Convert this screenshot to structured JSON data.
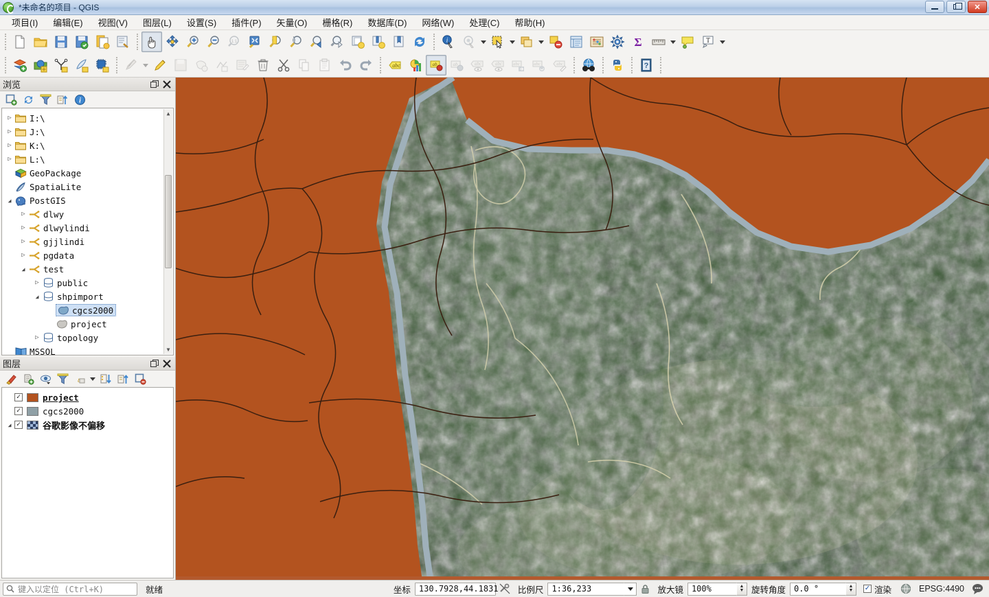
{
  "window": {
    "title": "*未命名的项目 - QGIS",
    "logo_icon": "qgis-logo-icon",
    "minimize_label": "最小化",
    "maximize_label": "最大化",
    "close_label": "关闭"
  },
  "menubar": {
    "items": [
      {
        "label": "项目(I)",
        "name": "menu-project"
      },
      {
        "label": "编辑(E)",
        "name": "menu-edit"
      },
      {
        "label": "视图(V)",
        "name": "menu-view"
      },
      {
        "label": "图层(L)",
        "name": "menu-layer"
      },
      {
        "label": "设置(S)",
        "name": "menu-settings"
      },
      {
        "label": "插件(P)",
        "name": "menu-plugins"
      },
      {
        "label": "矢量(O)",
        "name": "menu-vector"
      },
      {
        "label": "栅格(R)",
        "name": "menu-raster"
      },
      {
        "label": "数据库(D)",
        "name": "menu-database"
      },
      {
        "label": "网络(W)",
        "name": "menu-web"
      },
      {
        "label": "处理(C)",
        "name": "menu-processing"
      },
      {
        "label": "帮助(H)",
        "name": "menu-help"
      }
    ]
  },
  "toolbars": {
    "row1": [
      "new-project-icon",
      "open-project-icon",
      "save-project-icon",
      "save-project-as-icon",
      "new-print-layout-icon",
      "style-manager-icon",
      "sep",
      "pan-map-icon",
      "pan-to-selection-icon",
      "zoom-in-icon",
      "zoom-out-icon",
      "zoom-native-icon",
      "zoom-full-icon",
      "zoom-to-selection-icon",
      "zoom-to-layer-icon",
      "zoom-last-icon",
      "zoom-next-icon",
      "new-map-view-icon",
      "new-3d-map-view-icon",
      "new-bookmark-icon",
      "refresh-icon",
      "sep",
      "identify-features-icon",
      "measure-icon",
      "caret",
      "select-features-icon",
      "caret",
      "deselect-icon",
      "caret",
      "deselect-all-icon",
      "open-attribute-table-icon",
      "field-calculator-icon",
      "options-icon",
      "statistics-icon",
      "measure-line-icon",
      "caret",
      "map-tips-icon",
      "text-annotation-icon",
      "caret"
    ],
    "row2": [
      "add-layer-icon",
      "add-raster-layer-icon",
      "add-mesh-layer-icon",
      "add-delimited-text-icon",
      "add-virtual-layer-icon",
      "sep",
      "current-edits-icon",
      "caret2",
      "toggle-editing-icon",
      "save-layer-edits-icon",
      "add-polygon-feature-icon",
      "vertex-tool-icon",
      "modify-attributes-icon",
      "delete-selected-icon",
      "cut-features-icon",
      "copy-features-icon",
      "paste-features-icon",
      "undo-icon",
      "redo-icon",
      "sep",
      "label-icon",
      "diagram-icon",
      "pin-labels-icon",
      "show-hidden-labels-icon",
      "highlight-labels-icon",
      "show-unplaced-labels-icon",
      "move-label-icon",
      "rotate-label-icon",
      "change-label-icon",
      "sep",
      "metasearch-icon",
      "sep",
      "python-console-icon",
      "sep",
      "help-icon",
      "sep"
    ]
  },
  "browser_panel": {
    "title": "浏览",
    "float_label": "浮动",
    "close_label": "关闭",
    "toolbar": [
      "add-layer-icon",
      "refresh-icon",
      "filter-browser-icon",
      "collapse-all-icon",
      "properties-icon"
    ],
    "tree": [
      {
        "label": "I:\\",
        "icon": "folder-icon",
        "indent": 0,
        "twist": "collapsed"
      },
      {
        "label": "J:\\",
        "icon": "folder-icon",
        "indent": 0,
        "twist": "collapsed"
      },
      {
        "label": "K:\\",
        "icon": "folder-icon",
        "indent": 0,
        "twist": "collapsed"
      },
      {
        "label": "L:\\",
        "icon": "folder-icon",
        "indent": 0,
        "twist": "collapsed"
      },
      {
        "label": "GeoPackage",
        "icon": "geopackage-icon",
        "indent": 0,
        "twist": "none"
      },
      {
        "label": "SpatiaLite",
        "icon": "spatialite-icon",
        "indent": 0,
        "twist": "none"
      },
      {
        "label": "PostGIS",
        "icon": "postgis-elephant-icon",
        "indent": 0,
        "twist": "expanded"
      },
      {
        "label": "dlwy",
        "icon": "pg-connection-icon",
        "indent": 1,
        "twist": "collapsed"
      },
      {
        "label": "dlwylindi",
        "icon": "pg-connection-icon",
        "indent": 1,
        "twist": "collapsed"
      },
      {
        "label": "gjjlindi",
        "icon": "pg-connection-icon",
        "indent": 1,
        "twist": "collapsed"
      },
      {
        "label": "pgdata",
        "icon": "pg-connection-icon",
        "indent": 1,
        "twist": "collapsed"
      },
      {
        "label": "test",
        "icon": "pg-connection-icon",
        "indent": 1,
        "twist": "expanded"
      },
      {
        "label": "public",
        "icon": "schema-icon",
        "indent": 2,
        "twist": "collapsed"
      },
      {
        "label": "shpimport",
        "icon": "schema-icon",
        "indent": 2,
        "twist": "expanded"
      },
      {
        "label": "cgcs2000",
        "icon": "polygon-layer-icon",
        "indent": 3,
        "twist": "none",
        "selected": true
      },
      {
        "label": "project",
        "icon": "polygon-layer-gray-icon",
        "indent": 3,
        "twist": "none"
      },
      {
        "label": "topology",
        "icon": "schema-icon",
        "indent": 2,
        "twist": "collapsed"
      },
      {
        "label": "MSSQL",
        "icon": "mssql-icon",
        "indent": 0,
        "twist": "none"
      }
    ]
  },
  "layers_panel": {
    "title": "图层",
    "float_label": "浮动",
    "close_label": "关闭",
    "toolbar": [
      "open-layer-styling-icon",
      "add-group-icon",
      "manage-visibility-icon",
      "filter-legend-icon",
      "filter-expression-icon",
      "caret",
      "expand-all-icon",
      "collapse-all-icon",
      "remove-layer-icon"
    ],
    "layers": [
      {
        "name": "project",
        "checked": true,
        "swatch": "#b3531f",
        "style": "bold-underline",
        "twist": "none"
      },
      {
        "name": "cgcs2000",
        "checked": true,
        "swatch": "#8fa0a6",
        "style": "normal",
        "twist": "none"
      },
      {
        "name": "谷歌影像不偏移",
        "checked": true,
        "swatch": "raster-checker",
        "style": "cn",
        "twist": "expanded"
      }
    ]
  },
  "statusbar": {
    "locator_placeholder": "键入以定位 (Ctrl+K)",
    "locator_icon": "search-icon",
    "status_text": "就绪",
    "coordinate_label": "坐标",
    "coordinate_value": "130.7928,44.1831",
    "toggle_extents_icon": "toggle-extents-icon",
    "scale_label": "比例尺",
    "scale_value": "1:36,233",
    "scale_lock_icon": "lock-icon",
    "magnifier_label": "放大镜",
    "magnifier_value": "100%",
    "rotation_label": "旋转角度",
    "rotation_value": "0.0 °",
    "render_label": "渲染",
    "render_checked": true,
    "crs_icon": "globe-icon",
    "crs_value": "EPSG:4490",
    "messages_icon": "message-bubble-icon"
  },
  "map": {
    "polygon_fill": "#b3531f",
    "polygon_outline": "#3a1f10",
    "river_color": "#9fb0ba",
    "satellite_green": "#3c5c33",
    "satellite_light": "#d9d3b4"
  }
}
